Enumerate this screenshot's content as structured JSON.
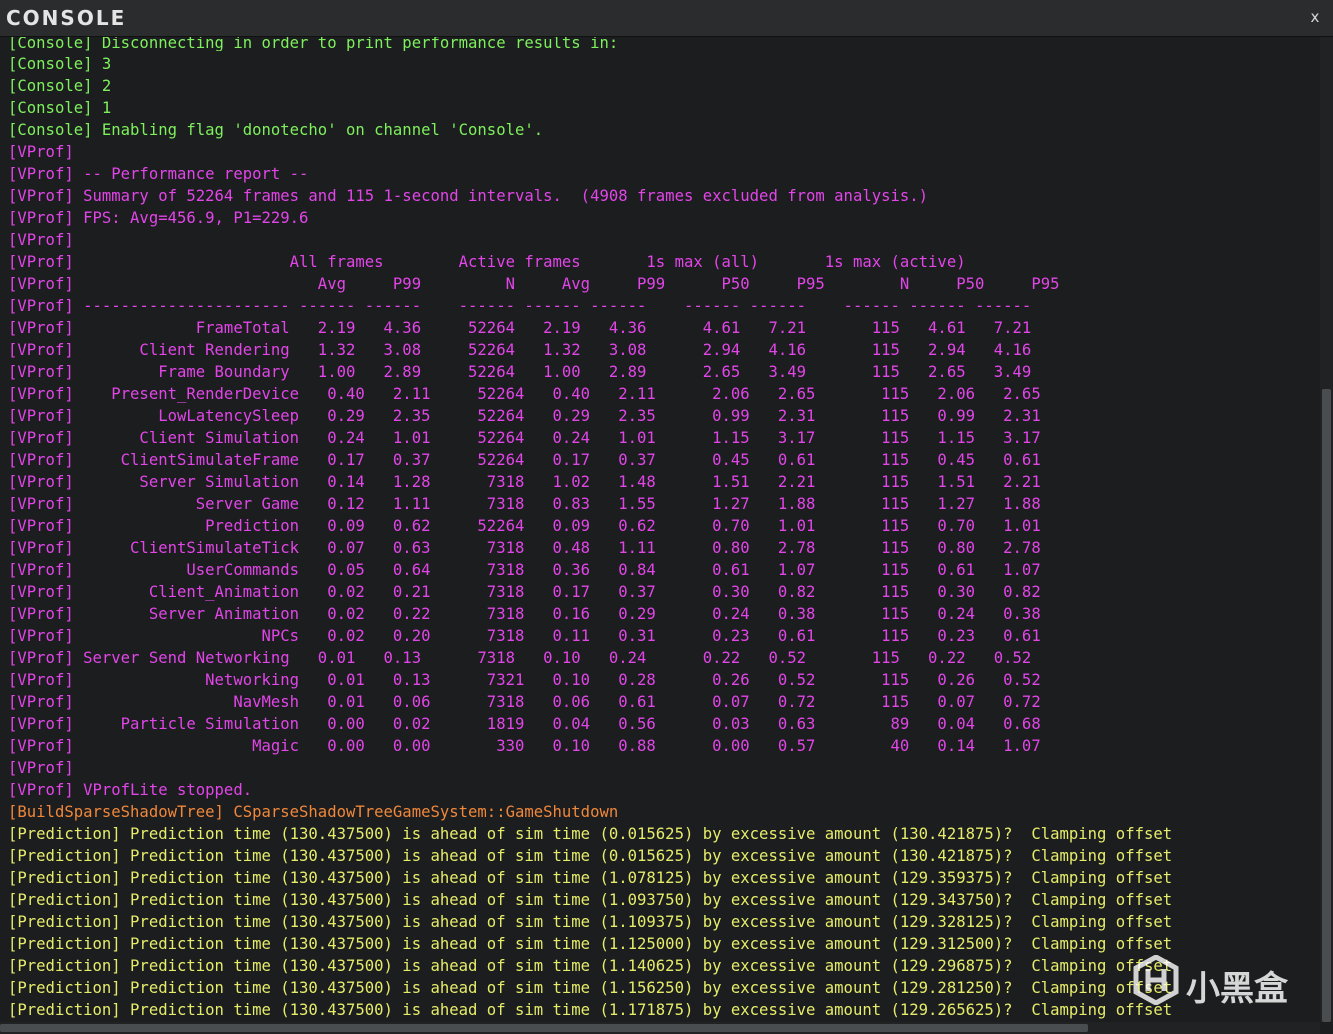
{
  "window": {
    "title": "CONSOLE",
    "close_glyph": "x"
  },
  "watermark": {
    "text": "小黑盒",
    "icon": "xiaoheihe-logo-icon"
  },
  "colors": {
    "console": "#7ef05c",
    "vprof": "#e245e8",
    "build": "#f0873a",
    "prediction": "#e6ec6a"
  },
  "log_top_clipped": "[Console] Disconnecting in order to print performance results in:",
  "log": [
    {
      "c": "console",
      "t": "[Console] 3"
    },
    {
      "c": "console",
      "t": "[Console] 2"
    },
    {
      "c": "console",
      "t": "[Console] 1"
    },
    {
      "c": "console",
      "t": "[Console] Enabling flag 'donotecho' on channel 'Console'."
    },
    {
      "c": "vprof",
      "t": "[VProf]"
    },
    {
      "c": "vprof",
      "t": "[VProf] -- Performance report --"
    },
    {
      "c": "vprof",
      "t": "[VProf] Summary of 52264 frames and 115 1-second intervals.  (4908 frames excluded from analysis.)"
    },
    {
      "c": "vprof",
      "t": "[VProf] FPS: Avg=456.9, P1=229.6"
    },
    {
      "c": "vprof",
      "t": "[VProf]"
    },
    {
      "c": "vprof",
      "t": "[VProf]                       All frames        Active frames       1s max (all)       1s max (active)"
    },
    {
      "c": "vprof",
      "t": "[VProf]                          Avg     P99         N     Avg     P99      P50     P95        N     P50     P95"
    },
    {
      "c": "vprof",
      "t": "[VProf] ---------------------- ------ ------    ------ ------ ------    ------ ------    ------ ------ ------"
    },
    {
      "c": "vprof",
      "t": "[VProf]             FrameTotal   2.19   4.36     52264   2.19   4.36      4.61   7.21       115   4.61   7.21"
    },
    {
      "c": "vprof",
      "t": "[VProf]       Client Rendering   1.32   3.08     52264   1.32   3.08      2.94   4.16       115   2.94   4.16"
    },
    {
      "c": "vprof",
      "t": "[VProf]         Frame Boundary   1.00   2.89     52264   1.00   2.89      2.65   3.49       115   2.65   3.49"
    },
    {
      "c": "vprof",
      "t": "[VProf]    Present_RenderDevice   0.40   2.11     52264   0.40   2.11      2.06   2.65       115   2.06   2.65"
    },
    {
      "c": "vprof",
      "t": "[VProf]         LowLatencySleep   0.29   2.35     52264   0.29   2.35      0.99   2.31       115   0.99   2.31"
    },
    {
      "c": "vprof",
      "t": "[VProf]       Client Simulation   0.24   1.01     52264   0.24   1.01      1.15   3.17       115   1.15   3.17"
    },
    {
      "c": "vprof",
      "t": "[VProf]     ClientSimulateFrame   0.17   0.37     52264   0.17   0.37      0.45   0.61       115   0.45   0.61"
    },
    {
      "c": "vprof",
      "t": "[VProf]       Server Simulation   0.14   1.28      7318   1.02   1.48      1.51   2.21       115   1.51   2.21"
    },
    {
      "c": "vprof",
      "t": "[VProf]             Server Game   0.12   1.11      7318   0.83   1.55      1.27   1.88       115   1.27   1.88"
    },
    {
      "c": "vprof",
      "t": "[VProf]              Prediction   0.09   0.62     52264   0.09   0.62      0.70   1.01       115   0.70   1.01"
    },
    {
      "c": "vprof",
      "t": "[VProf]      ClientSimulateTick   0.07   0.63      7318   0.48   1.11      0.80   2.78       115   0.80   2.78"
    },
    {
      "c": "vprof",
      "t": "[VProf]            UserCommands   0.05   0.64      7318   0.36   0.84      0.61   1.07       115   0.61   1.07"
    },
    {
      "c": "vprof",
      "t": "[VProf]        Client_Animation   0.02   0.21      7318   0.17   0.37      0.30   0.82       115   0.30   0.82"
    },
    {
      "c": "vprof",
      "t": "[VProf]        Server Animation   0.02   0.22      7318   0.16   0.29      0.24   0.38       115   0.24   0.38"
    },
    {
      "c": "vprof",
      "t": "[VProf]                    NPCs   0.02   0.20      7318   0.11   0.31      0.23   0.61       115   0.23   0.61"
    },
    {
      "c": "vprof",
      "t": "[VProf] Server Send Networking   0.01   0.13      7318   0.10   0.24      0.22   0.52       115   0.22   0.52"
    },
    {
      "c": "vprof",
      "t": "[VProf]              Networking   0.01   0.13      7321   0.10   0.28      0.26   0.52       115   0.26   0.52"
    },
    {
      "c": "vprof",
      "t": "[VProf]                 NavMesh   0.01   0.06      7318   0.06   0.61      0.07   0.72       115   0.07   0.72"
    },
    {
      "c": "vprof",
      "t": "[VProf]     Particle Simulation   0.00   0.02      1819   0.04   0.56      0.03   0.63        89   0.04   0.68"
    },
    {
      "c": "vprof",
      "t": "[VProf]                   Magic   0.00   0.00       330   0.10   0.88      0.00   0.57        40   0.14   1.07"
    },
    {
      "c": "vprof",
      "t": "[VProf]"
    },
    {
      "c": "vprof",
      "t": "[VProf] VProfLite stopped."
    },
    {
      "c": "build",
      "t": "[BuildSparseShadowTree] CSparseShadowTreeGameSystem::GameShutdown"
    },
    {
      "c": "pred",
      "t": "[Prediction] Prediction time (130.437500) is ahead of sim time (0.015625) by excessive amount (130.421875)?  Clamping offset"
    },
    {
      "c": "pred",
      "t": "[Prediction] Prediction time (130.437500) is ahead of sim time (0.015625) by excessive amount (130.421875)?  Clamping offset"
    },
    {
      "c": "pred",
      "t": "[Prediction] Prediction time (130.437500) is ahead of sim time (1.078125) by excessive amount (129.359375)?  Clamping offset"
    },
    {
      "c": "pred",
      "t": "[Prediction] Prediction time (130.437500) is ahead of sim time (1.093750) by excessive amount (129.343750)?  Clamping offset"
    },
    {
      "c": "pred",
      "t": "[Prediction] Prediction time (130.437500) is ahead of sim time (1.109375) by excessive amount (129.328125)?  Clamping offset"
    },
    {
      "c": "pred",
      "t": "[Prediction] Prediction time (130.437500) is ahead of sim time (1.125000) by excessive amount (129.312500)?  Clamping offset"
    },
    {
      "c": "pred",
      "t": "[Prediction] Prediction time (130.437500) is ahead of sim time (1.140625) by excessive amount (129.296875)?  Clamping offset"
    },
    {
      "c": "pred",
      "t": "[Prediction] Prediction time (130.437500) is ahead of sim time (1.156250) by excessive amount (129.281250)?  Clamping offset"
    },
    {
      "c": "pred",
      "t": "[Prediction] Prediction time (130.437500) is ahead of sim time (1.171875) by excessive amount (129.265625)?  Clamping offset"
    }
  ]
}
